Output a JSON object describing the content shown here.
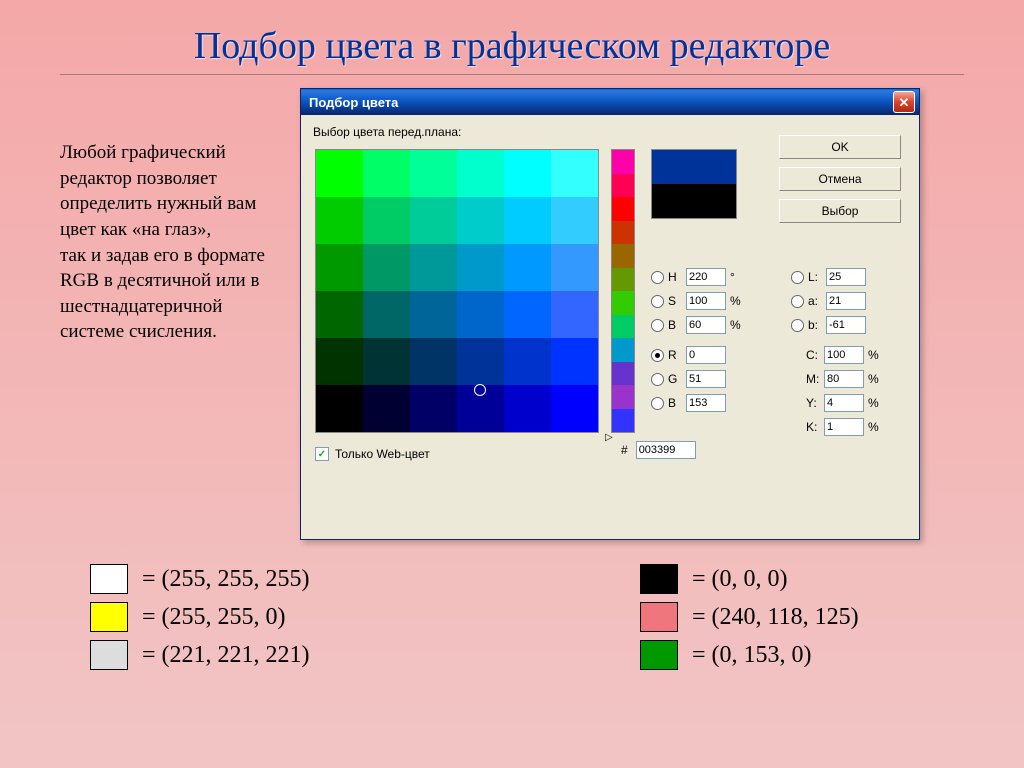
{
  "slide": {
    "title": "Подбор цвета в графическом редакторе",
    "paragraph": "Любой графический редактор позволяет определить нужный вам цвет как «на глаз»,\nтак и задав его в формате\nRGB в десятичной или в шестнадцатеричной системе счисления."
  },
  "dialog": {
    "title": "Подбор цвета",
    "label": "Выбор цвета перед.плана:",
    "buttons": {
      "ok": "OK",
      "cancel": "Отмена",
      "pick": "Выбор"
    },
    "checkbox": "Только Web-цвет",
    "hsb": {
      "h_label": "H",
      "s_label": "S",
      "b_label": "B",
      "h": "220",
      "s": "100",
      "b": "60",
      "deg": "°",
      "pct": "%"
    },
    "lab": {
      "l_label": "L:",
      "a_label": "a:",
      "b_label": "b:",
      "l": "25",
      "a": "21",
      "b2": "-61"
    },
    "rgb": {
      "r_label": "R",
      "g_label": "G",
      "b_label": "B",
      "r": "0",
      "g": "51",
      "b": "153"
    },
    "cmyk": {
      "c_label": "C:",
      "m_label": "M:",
      "y_label": "Y:",
      "k_label": "K:",
      "c": "100",
      "m": "80",
      "y": "4",
      "k": "1",
      "pct": "%"
    },
    "hex": {
      "hash": "#",
      "value": "003399"
    }
  },
  "examples": {
    "left": [
      {
        "color": "#ffffff",
        "text": "= (255, 255, 255)"
      },
      {
        "color": "#ffff00",
        "text": "= (255, 255, 0)"
      },
      {
        "color": "#dddddd",
        "text": "= (221, 221, 221)"
      }
    ],
    "right": [
      {
        "color": "#000000",
        "text": "= (0, 0, 0)"
      },
      {
        "color": "#f0767d",
        "text": "= (240, 118, 125)"
      },
      {
        "color": "#009900",
        "text": "= (0, 153, 0)"
      }
    ]
  }
}
